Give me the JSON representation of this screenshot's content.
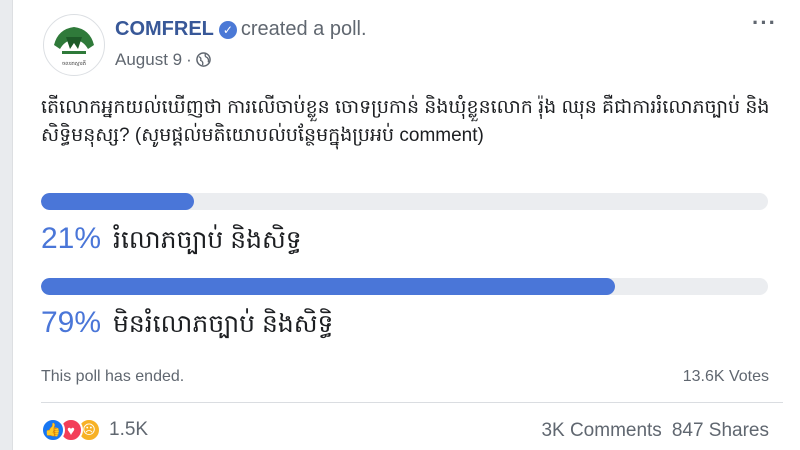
{
  "post": {
    "page_name": "COMFREL",
    "action": "created a poll.",
    "date": "August 9",
    "separator": "·",
    "more_label": "···",
    "avatar_logo_text": "ចលនាស្មារតី"
  },
  "poll": {
    "question": "តើលោកអ្នកយល់ឃើញថា ការលើចាប់ខ្លួន ចោទប្រកាន់ និងឃុំខ្លួនលោក រ៉ុង ឈុន គឺជាការរំលោភច្បាប់ និងសិទ្ធិមនុស្ស? (សូមផ្តល់មតិយោបល់បន្ថែមក្នុងប្រអប់ comment)",
    "options": [
      {
        "percent_label": "21%",
        "percent": 21,
        "label": "រំលោភច្បាប់ និងសិទ្ធ"
      },
      {
        "percent_label": "79%",
        "percent": 79,
        "label": "មិនរំលោភច្បាប់ និងសិទ្ធិ"
      }
    ],
    "status": "This poll has ended.",
    "votes": "13.6K Votes",
    "accent_color": "#4a76d8"
  },
  "footer": {
    "reaction_count": "1.5K",
    "comments": "3K Comments",
    "shares": "847 Shares"
  }
}
